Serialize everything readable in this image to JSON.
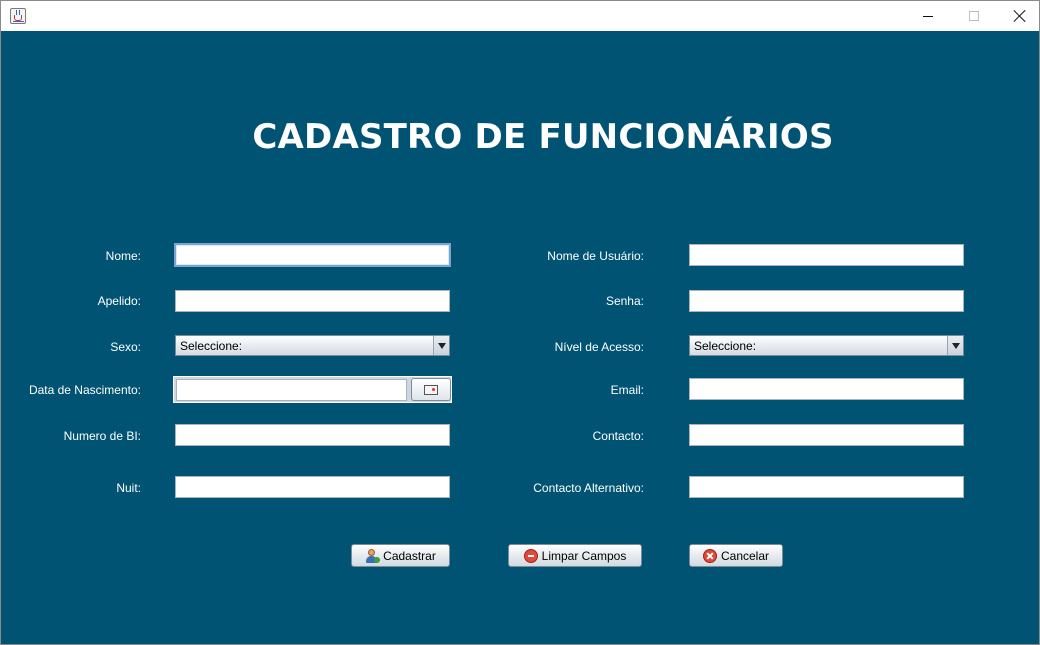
{
  "window": {
    "app_icon": "java-cup-icon",
    "controls": [
      "minimize-icon",
      "maximize-icon",
      "close-icon"
    ]
  },
  "title": "CADASTRO DE FUNCIONÁRIOS",
  "colors": {
    "background": "#005373",
    "text": "#ffffff"
  },
  "left_form": {
    "nome_label": "Nome:",
    "apelido_label": "Apelido:",
    "sexo_label": "Sexo:",
    "sexo_value": "Seleccione:",
    "data_label": "Data de Nascimento:",
    "bi_label": "Numero de BI:",
    "nuit_label": "Nuit:"
  },
  "right_form": {
    "usuario_label": "Nome de Usuário:",
    "senha_label": "Senha:",
    "nivel_label": "Nível de Acesso:",
    "nivel_value": "Seleccione:",
    "email_label": "Email:",
    "contacto_label": "Contacto:",
    "contacto_alt_label": "Contacto Alternativo:"
  },
  "buttons": {
    "cadastrar": "Cadastrar",
    "limpar": "Limpar Campos",
    "cancelar": "Cancelar"
  }
}
